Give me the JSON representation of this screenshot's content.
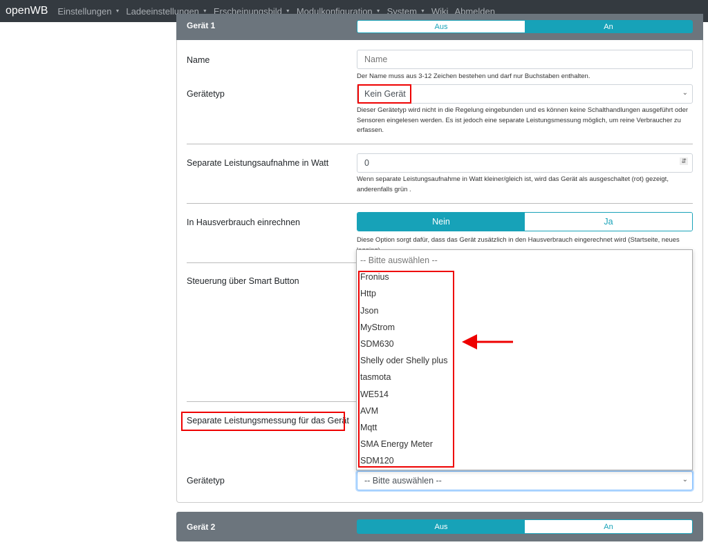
{
  "nav": {
    "brand": "openWB",
    "items": [
      {
        "label": "Einstellungen",
        "dropdown": true
      },
      {
        "label": "Ladeeinstellungen",
        "dropdown": true
      },
      {
        "label": "Erscheinungsbild",
        "dropdown": true
      },
      {
        "label": "Modulkonfiguration",
        "dropdown": true
      },
      {
        "label": "System",
        "dropdown": true
      },
      {
        "label": "Wiki",
        "dropdown": false
      },
      {
        "label": "Abmelden",
        "dropdown": false
      }
    ]
  },
  "device1": {
    "title": "Gerät 1",
    "toggle": {
      "off": "Aus",
      "on": "An",
      "selected": "An"
    },
    "name_label": "Name",
    "name_placeholder": "Name",
    "name_help": "Der Name muss aus 3-12 Zeichen bestehen und darf nur Buchstaben enthalten.",
    "type_label": "Gerätetyp",
    "type_value": "Kein Gerät",
    "type_help": "Dieser Gerätetyp wird nicht in die Regelung eingebunden und es können keine Schalthandlungen ausgeführt oder Sensoren eingelesen werden. Es ist jedoch eine separate Leistungsmessung möglich, um reine Verbraucher zu erfassen.",
    "power_label": "Separate Leistungsaufnahme in Watt",
    "power_value": "0",
    "power_help": "Wenn separate Leistungsaufnahme in Watt kleiner/gleich ist, wird das Gerät als ausgeschaltet (rot) gezeigt, anderenfalls grün .",
    "house_label": "In Hausverbrauch einrechnen",
    "house_toggle": {
      "no": "Nein",
      "yes": "Ja",
      "selected": "Nein"
    },
    "house_help": "Diese Option sorgt dafür, dass das Gerät zusätzlich in den Hausverbrauch eingerechnet wird (Startseite, neues logging).",
    "smart_label": "Steuerung über Smart Button",
    "meter_label": "Separate Leistungsmessung für das Gerät",
    "meter_type_label": "Gerätetyp",
    "meter_type_value": "-- Bitte auswählen --"
  },
  "dropdown": {
    "options": [
      "-- Bitte auswählen --",
      "Fronius",
      "Http",
      "Json",
      "MyStrom",
      "SDM630",
      "Shelly oder Shelly plus",
      "tasmota",
      "WE514",
      "AVM",
      "Mqtt",
      "SMA Energy Meter",
      "SDM120"
    ]
  },
  "device2": {
    "title": "Gerät 2",
    "toggle": {
      "off": "Aus",
      "on": "An",
      "selected": "Aus"
    }
  },
  "colors": {
    "accent": "#17a2b8",
    "navbar": "#343a40",
    "card_header": "#6c757d",
    "annotation": "#e00000"
  }
}
